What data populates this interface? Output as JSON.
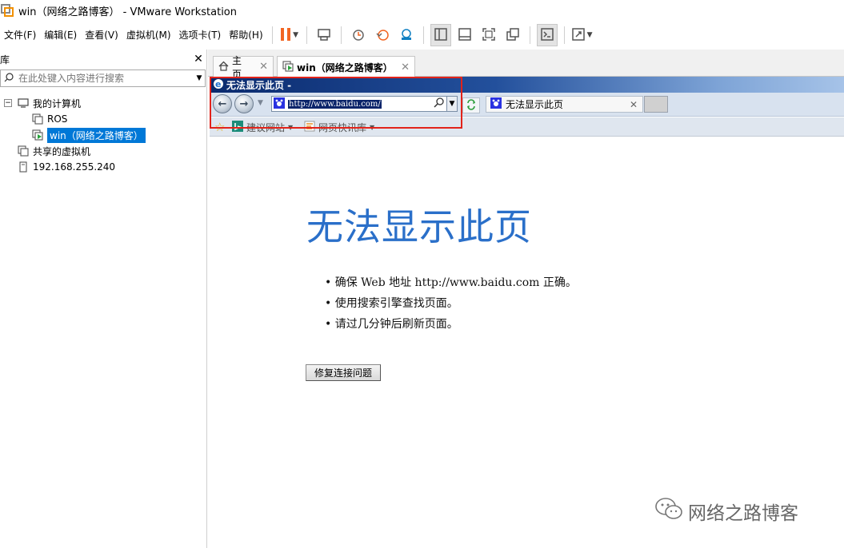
{
  "window": {
    "title": "win（网络之路博客） - VMware Workstation",
    "icon": "vmware-logo-icon"
  },
  "menu": [
    "文件(F)",
    "编辑(E)",
    "查看(V)",
    "虚拟机(M)",
    "选项卡(T)",
    "帮助(H)"
  ],
  "toolbar": {
    "icons": [
      "pause-icon",
      "send-keys-icon",
      "snapshot-icon",
      "revert-snapshot-icon",
      "snapshot-manager-icon",
      "library-view-icon",
      "thumbnail-bar-icon",
      "fullscreen-icon",
      "unity-icon",
      "console-icon",
      "stretch-icon"
    ],
    "accent": "#f26522"
  },
  "library": {
    "title": "库",
    "search_placeholder": "在此处键入内容进行搜索",
    "tree": {
      "my_computer": "我的计算机",
      "vm1": "ROS",
      "vm2": "win（网络之路博客）",
      "shared": "共享的虚拟机",
      "remote": "192.168.255.240"
    }
  },
  "tabs": {
    "home": "主页",
    "vm": "win（网络之路博客）"
  },
  "ie": {
    "window_title": "无法显示此页 -",
    "address": "http://www.baidu.com/",
    "tab_title": "无法显示此页",
    "favorites": [
      "建议网站",
      "网页快讯库"
    ]
  },
  "error_page": {
    "heading": "无法显示此页",
    "bullets": [
      "• 确保 Web 地址 http://www.baidu.com 正确。",
      "• 使用搜索引擎查找页面。",
      "• 请过几分钟后刷新页面。"
    ],
    "fix_button": "修复连接问题"
  },
  "watermark": "网络之路博客",
  "colors": {
    "selection": "#0078d7",
    "ie_title_bar": "#23509c",
    "error_heading": "#2a6fc9",
    "highlight_box": "#e2231a"
  }
}
